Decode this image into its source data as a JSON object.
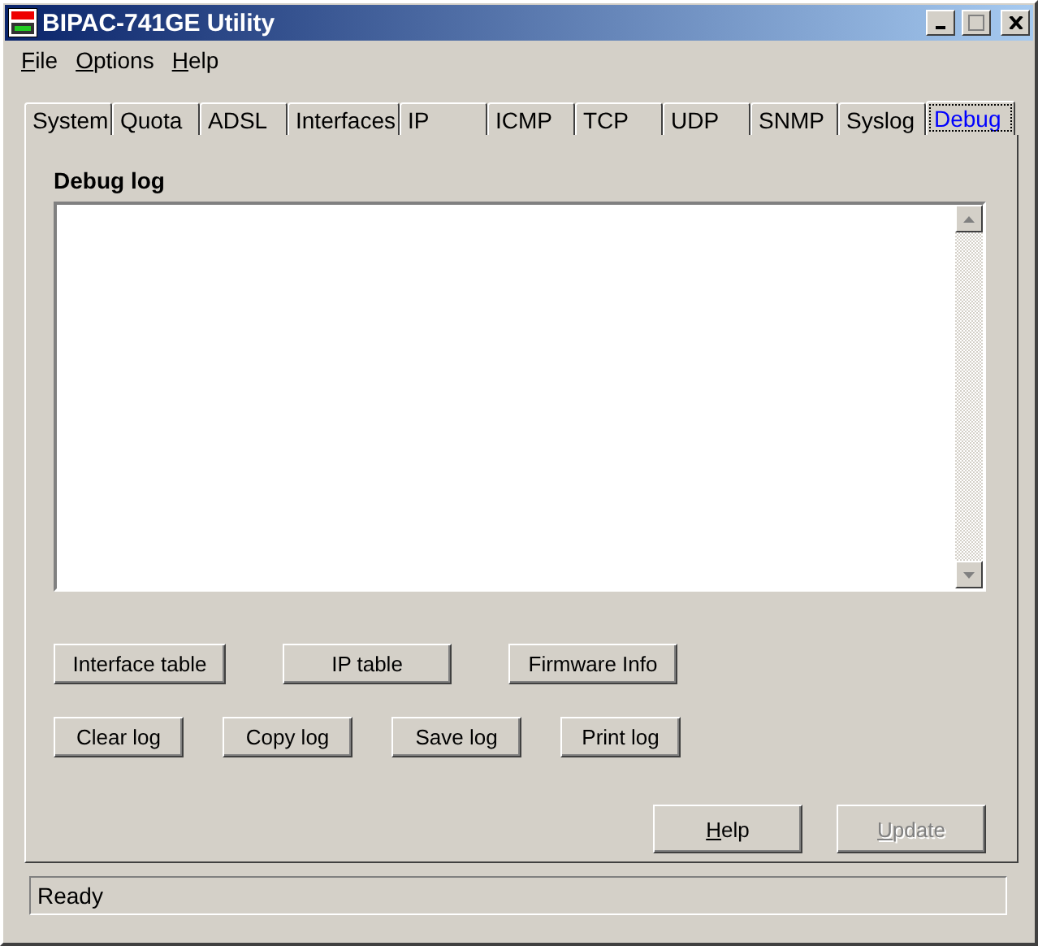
{
  "window": {
    "title": "BIPAC-741GE Utility"
  },
  "menu": [
    {
      "label": "File"
    },
    {
      "label": "Options"
    },
    {
      "label": "Help"
    }
  ],
  "tabs": [
    {
      "label": "System",
      "selected": false
    },
    {
      "label": "Quota",
      "selected": false
    },
    {
      "label": "ADSL",
      "selected": false
    },
    {
      "label": "Interfaces",
      "selected": false
    },
    {
      "label": "IP",
      "selected": false
    },
    {
      "label": "ICMP",
      "selected": false
    },
    {
      "label": "TCP",
      "selected": false
    },
    {
      "label": "UDP",
      "selected": false
    },
    {
      "label": "SNMP",
      "selected": false
    },
    {
      "label": "Syslog",
      "selected": false
    },
    {
      "label": "Debug",
      "selected": true
    }
  ],
  "debug_log": {
    "label": "Debug log"
  },
  "log_buttons": [
    [
      {
        "label": "Interface table"
      },
      {
        "label": "IP table"
      },
      {
        "label": "Firmware Info"
      }
    ],
    [
      {
        "label": "Clear log"
      },
      {
        "label": "Copy log"
      },
      {
        "label": "Save log"
      },
      {
        "label": "Print log"
      }
    ]
  ],
  "dialog_buttons": [
    {
      "label": "Help",
      "disabled": false
    },
    {
      "label": "Update",
      "disabled": true
    }
  ],
  "status_bar": "Ready"
}
